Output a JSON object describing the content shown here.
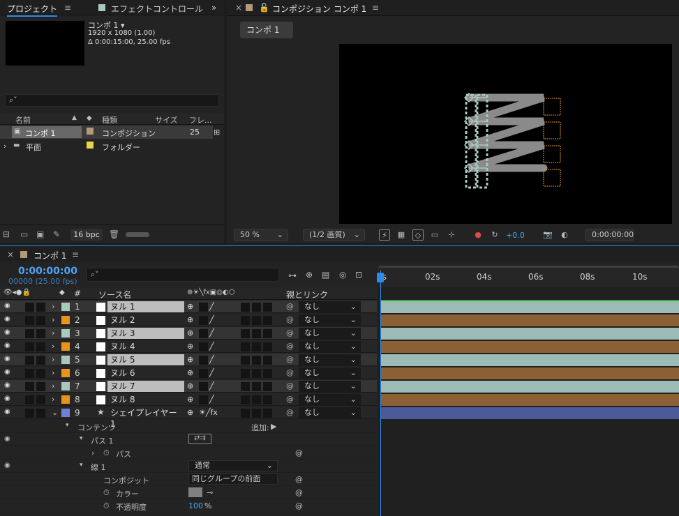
{
  "project_panel": {
    "tab_project": "プロジェクト",
    "tab_effects": "エフェクトコントロール",
    "comp_name": "コンポ 1 ▾",
    "comp_resolution": "1920 x 1080 (1.00)",
    "comp_duration": "Δ 0:00:15:00, 25.00 fps",
    "search_placeholder": "",
    "columns": {
      "name": "名前",
      "type": "種類",
      "size": "サイズ",
      "frames": "フレ..."
    },
    "items": [
      {
        "name": "コンポ 1",
        "type": "コンポジション",
        "frames": "25",
        "color": "#b49a7a"
      },
      {
        "name": "平面",
        "type": "フォルダー",
        "frames": "",
        "color": "#e6d544"
      }
    ],
    "bpc": "16 bpc"
  },
  "comp_panel": {
    "title": "コンポジション コンポ 1",
    "tab": "コンポ 1",
    "zoom": "50 %",
    "quality": "(1/2 画質)",
    "exposure": "+0.0",
    "timecode": "0:00:00:00"
  },
  "timeline": {
    "tab": "コンポ 1",
    "timecode": "0:00:00:00",
    "frames": "00000 (25.00 fps)",
    "ruler": [
      "0s",
      "02s",
      "04s",
      "06s",
      "08s",
      "10s"
    ],
    "headers": {
      "num": "#",
      "source": "ソース名",
      "parent": "親とリンク"
    },
    "layers": [
      {
        "num": "1",
        "name": "ヌル 1",
        "color": "#a8c8c0",
        "selected": true,
        "parent": "なし"
      },
      {
        "num": "2",
        "name": "ヌル 2",
        "color": "#e8931c",
        "selected": false,
        "parent": "なし"
      },
      {
        "num": "3",
        "name": "ヌル 3",
        "color": "#a8c8c0",
        "selected": true,
        "parent": "なし"
      },
      {
        "num": "4",
        "name": "ヌル 4",
        "color": "#e8931c",
        "selected": false,
        "parent": "なし"
      },
      {
        "num": "5",
        "name": "ヌル 5",
        "color": "#a8c8c0",
        "selected": true,
        "parent": "なし"
      },
      {
        "num": "6",
        "name": "ヌル 6",
        "color": "#e8931c",
        "selected": false,
        "parent": "なし"
      },
      {
        "num": "7",
        "name": "ヌル 7",
        "color": "#a8c8c0",
        "selected": true,
        "parent": "なし"
      },
      {
        "num": "8",
        "name": "ヌル 8",
        "color": "#e8931c",
        "selected": false,
        "parent": "なし"
      },
      {
        "num": "9",
        "name": "シェイプレイヤー 1",
        "color": "#7080d8",
        "selected": false,
        "parent": "なし"
      }
    ],
    "props": {
      "contents": "コンテンツ",
      "add": "追加:",
      "path1": "パス 1",
      "path": "パス",
      "stroke": "線 1",
      "stroke_mode": "通常",
      "composite_label": "コンポジット",
      "composite_value": "同じグループの前面",
      "color_label": "カラー",
      "opacity_label": "不透明度",
      "opacity_value": "100",
      "opacity_unit": "%"
    }
  },
  "colors": {
    "accent": "#2d8ceb",
    "teal_bar": "#9dbbb6",
    "orange_bar": "#8b6034",
    "purple_bar": "#4b5a99"
  }
}
